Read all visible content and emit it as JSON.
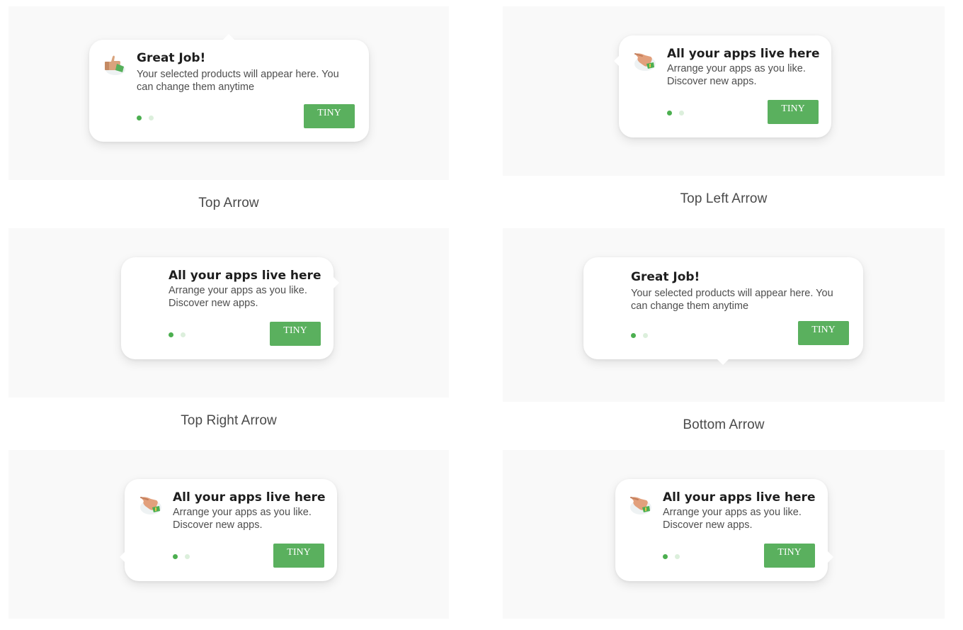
{
  "colors": {
    "accent": "#5ab05e",
    "panel": "#f9f9f9",
    "dot_active": "#4caf50",
    "dot_inactive": "#dcefdc"
  },
  "tooltips": [
    {
      "caption": "Top Arrow",
      "title": "Great Job!",
      "body_line1": "Your selected products will appear here. You",
      "body_line2": "can change them anytime",
      "button": "TINY",
      "icon": "thumbs-up-icon",
      "pages": 2,
      "current_page": 1
    },
    {
      "caption": "Top Left Arrow",
      "title": "All your apps live here",
      "body_line1": "Arrange your apps as you like.",
      "body_line2": "Discover new apps.",
      "button": "TINY",
      "icon": "pointing-hand-icon",
      "pages": 2,
      "current_page": 1
    },
    {
      "caption": "Top Right Arrow",
      "title": "All your apps live here",
      "body_line1": "Arrange your apps as you like.",
      "body_line2": "Discover new apps.",
      "button": "TINY",
      "icon": "",
      "pages": 2,
      "current_page": 1
    },
    {
      "caption": "Bottom Arrow",
      "title": "Great Job!",
      "body_line1": "Your selected products will appear here. You",
      "body_line2": "can change them anytime",
      "button": "TINY",
      "icon": "",
      "pages": 2,
      "current_page": 1
    },
    {
      "caption": "",
      "title": "All your apps live here",
      "body_line1": "Arrange your apps as you like.",
      "body_line2": "Discover new apps.",
      "button": "TINY",
      "icon": "pointing-hand-icon",
      "pages": 2,
      "current_page": 1
    },
    {
      "caption": "",
      "title": "All your apps live here",
      "body_line1": "Arrange your apps as you like.",
      "body_line2": "Discover new apps.",
      "button": "TINY",
      "icon": "pointing-hand-icon",
      "pages": 2,
      "current_page": 1
    }
  ]
}
